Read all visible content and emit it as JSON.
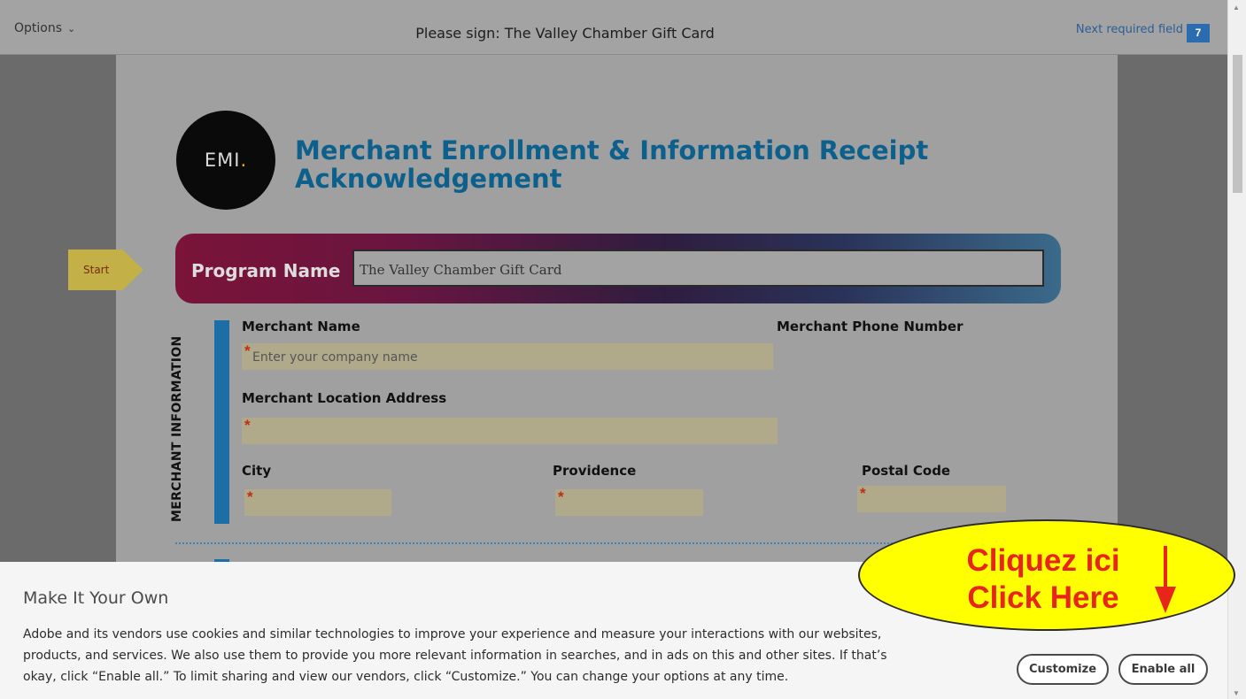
{
  "topbar": {
    "options_label": "Options",
    "title": "Please sign: The Valley Chamber Gift Card",
    "next_required_label": "Next required field",
    "next_required_count": "7"
  },
  "form": {
    "logo_text": "EMI",
    "logo_dot": ".",
    "title": "Merchant Enrollment & Information Receipt Acknowledgement",
    "start_tag": "Start",
    "program_name_label": "Program Name",
    "program_name_value": "The Valley Chamber Gift Card",
    "section_label": "MERCHANT INFORMATION",
    "merchant_name_label": "Merchant Name",
    "merchant_name_placeholder": "Enter your company name",
    "merchant_phone_label": "Merchant Phone Number",
    "merchant_address_label": "Merchant Location Address",
    "city_label": "City",
    "province_label": "Providence",
    "postal_label": "Postal Code",
    "required_marker": "*"
  },
  "cookie": {
    "title": "Make It Your Own",
    "body": "Adobe and its vendors use cookies and similar technologies to improve your experience and measure your interactions with our websites, products, and services. We also use them to provide you more relevant information in searches, and in ads on this and other sites. If that’s okay, click “Enable all.” To limit sharing and view our vendors, click “Customize.” You can change your options at any time.",
    "customize_label": "Customize",
    "enable_all_label": "Enable all"
  },
  "callout": {
    "line1": "Cliquez ici",
    "line2": "Click Here"
  }
}
